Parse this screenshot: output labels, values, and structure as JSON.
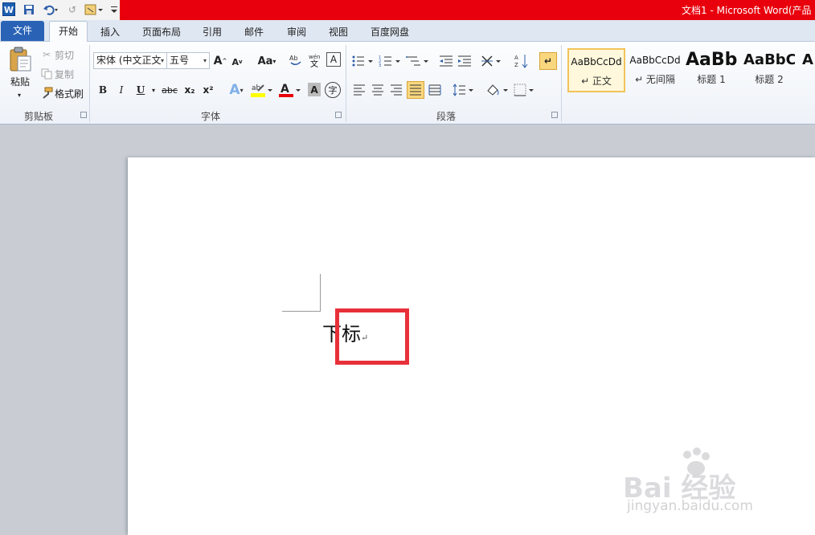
{
  "titlebar": {
    "title": "文档1 - Microsoft Word(产品"
  },
  "tabs": {
    "file": "文件",
    "home": "开始",
    "insert": "插入",
    "layout": "页面布局",
    "references": "引用",
    "mailings": "邮件",
    "review": "审阅",
    "view": "视图",
    "baidu": "百度网盘"
  },
  "clipboard": {
    "paste": "粘贴",
    "cut": "剪切",
    "copy": "复制",
    "format_painter": "格式刷",
    "label": "剪贴板"
  },
  "font": {
    "name": "宋体 (中文正文",
    "size": "五号",
    "grow": "A",
    "shrink": "A",
    "change_case": "Aa",
    "bold": "B",
    "italic": "I",
    "underline": "U",
    "strike": "abc",
    "subscript": "x₂",
    "superscript": "x²",
    "label": "字体"
  },
  "paragraph": {
    "label": "段落"
  },
  "styles": [
    {
      "sample": "AaBbCcDd",
      "name": "↵ 正文"
    },
    {
      "sample": "AaBbCcDd",
      "name": "↵ 无间隔"
    },
    {
      "sample": "AaBb",
      "name": "标题 1"
    },
    {
      "sample": "AaBbC",
      "name": "标题 2"
    },
    {
      "sample": "A",
      "name": ""
    }
  ],
  "document": {
    "text": "下标",
    "para_mark": "↵"
  },
  "watermark": {
    "brand": "Bai  经验",
    "url": "jingyan.baidu.com"
  },
  "colors": {
    "title_bar": "#e8000c",
    "file_tab": "#2a63b6",
    "highlight_box": "#e8303a"
  }
}
